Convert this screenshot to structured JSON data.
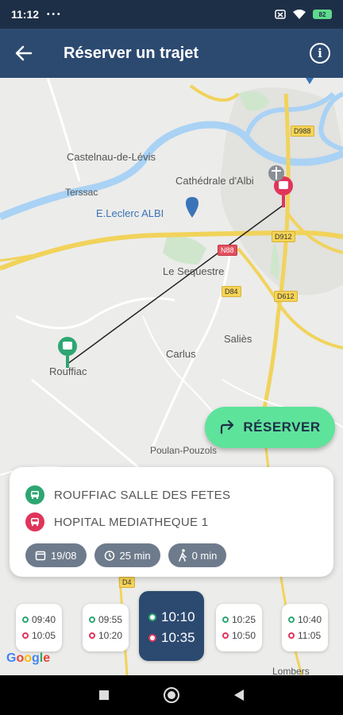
{
  "status_bar": {
    "time": "11:12",
    "dots": "•••",
    "battery": "82"
  },
  "app_bar": {
    "title": "Réserver un trajet",
    "info_glyph": "i"
  },
  "map": {
    "labels": {
      "castelnau": "Castelnau-de-Lévis",
      "cathedrale": "Cathédrale d'Albi",
      "terssac": "Terssac",
      "leclerc": "E.Leclerc ALBI",
      "sequestre": "Le Sequestre",
      "salies": "Saliès",
      "carlus": "Carlus",
      "rouffiac": "Rouffiac",
      "poulan": "Poulan-Pouzols",
      "lombers": "Lombers"
    },
    "roads": {
      "d988": "D988",
      "d912": "D912",
      "n88": "N88",
      "d84": "D84",
      "d612": "D612",
      "d4": "D4"
    }
  },
  "reserve_button": {
    "label": "RÉSERVER",
    "icon": "turn-right-arrow-icon",
    "color": "#5ee39b"
  },
  "trip": {
    "origin": {
      "name": "ROUFFIAC SALLE DES FETES",
      "color": "#2ea672"
    },
    "destination": {
      "name": "HOPITAL MEDIATHEQUE 1",
      "color": "#e0355a"
    },
    "date": "19/08",
    "duration": "25 min",
    "walk": "0 min"
  },
  "times": [
    {
      "dep": "09:40",
      "arr": "10:05"
    },
    {
      "dep": "09:55",
      "arr": "10:20"
    },
    {
      "dep": "10:10",
      "arr": "10:35",
      "selected": true
    },
    {
      "dep": "10:25",
      "arr": "10:50"
    },
    {
      "dep": "10:40",
      "arr": "11:05"
    }
  ],
  "google_logo": "Google",
  "colors": {
    "appbar": "#2c4a70",
    "statusbar": "#1d2f47",
    "chip": "#6e7b8c"
  }
}
